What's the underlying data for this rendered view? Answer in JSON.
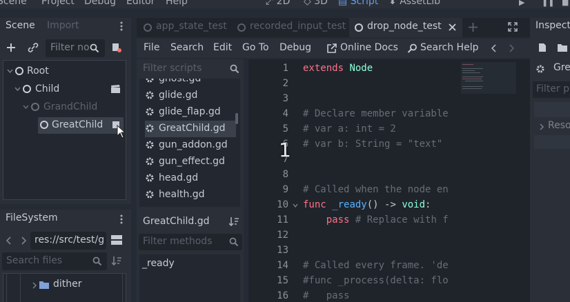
{
  "menu": {
    "items": [
      "Scene",
      "Project",
      "Debug",
      "Editor",
      "Help"
    ],
    "workspaces": [
      "2D",
      "3D",
      "Script",
      "AssetLib"
    ]
  },
  "scene_dock": {
    "tabs": [
      "Scene",
      "Import"
    ],
    "filter_placeholder": "Filter no",
    "tree": [
      {
        "label": "Root"
      },
      {
        "label": "Child"
      },
      {
        "label": "GrandChild"
      },
      {
        "label": "GreatChild"
      }
    ]
  },
  "filesystem": {
    "tab": "FileSystem",
    "path": "res://src/test/g",
    "search_placeholder": "Search files",
    "folder": "dither"
  },
  "script_tabs": [
    {
      "label": "app_state_test"
    },
    {
      "label": "recorded_input_test"
    },
    {
      "label": "drop_node_test"
    }
  ],
  "script_menu": {
    "items": [
      "File",
      "Search",
      "Edit",
      "Go To",
      "Debug"
    ],
    "online_docs": "Online Docs",
    "search_help": "Search Help"
  },
  "script_list": {
    "filter_placeholder": "Filter scripts",
    "items": [
      "ghost.gd",
      "glide.gd",
      "glide_flap.gd",
      "GreatChild.gd",
      "gun_addon.gd",
      "gun_effect.gd",
      "head.gd",
      "health.gd"
    ],
    "selected": "GreatChild.gd",
    "current_script": "GreatChild.gd",
    "methods_placeholder": "Filter methods",
    "methods": [
      "_ready"
    ]
  },
  "code_lines": [
    {
      "n": "1",
      "text": "extends Node"
    },
    {
      "n": "2",
      "text": ""
    },
    {
      "n": "3",
      "text": ""
    },
    {
      "n": "4",
      "text": "# Declare member variable"
    },
    {
      "n": "5",
      "text": "# var a: int = 2"
    },
    {
      "n": "6",
      "text": "# var b: String = \"text\""
    },
    {
      "n": "7",
      "text": ""
    },
    {
      "n": "8",
      "text": ""
    },
    {
      "n": "9",
      "text": "# Called when the node en"
    },
    {
      "n": "10",
      "text": "func _ready() -> void:"
    },
    {
      "n": "11",
      "text": "    pass # Replace with f"
    },
    {
      "n": "12",
      "text": ""
    },
    {
      "n": "13",
      "text": ""
    },
    {
      "n": "14",
      "text": "# Called every frame. 'de"
    },
    {
      "n": "15",
      "text": "#func _process(delta: flo"
    },
    {
      "n": "16",
      "text": "#   pass"
    }
  ],
  "overlay_count": "1",
  "inspector": {
    "tab": "Inspect",
    "node": "Gre",
    "filter_placeholder": "Filter p",
    "section": "Reso"
  },
  "colors": {
    "accent": "#699ce8",
    "keyword": "#ff7085",
    "type": "#8effda",
    "comment": "#676d76"
  }
}
